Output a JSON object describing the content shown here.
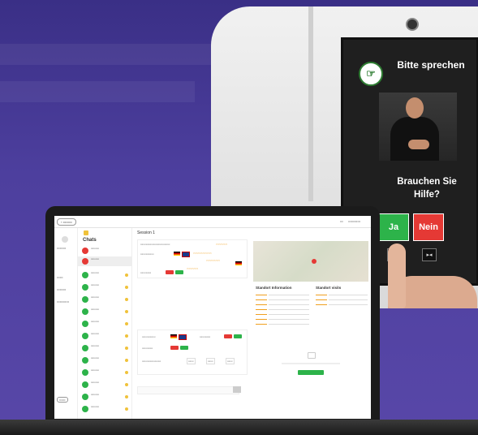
{
  "kiosk": {
    "prompt": "Bitte sprechen",
    "question": "Brauchen Sie Hilfe?",
    "yes_label": "Ja",
    "no_label": "Nein",
    "logo_icon": "sign-language-logo-icon"
  },
  "laptop": {
    "chats_title": "Chats",
    "section_title": "Session 1",
    "info_title": "Standort Information",
    "info_title2": "Standort visits"
  },
  "colors": {
    "yes": "#2db34a",
    "no": "#e53935",
    "background": "#4d3f9e"
  }
}
